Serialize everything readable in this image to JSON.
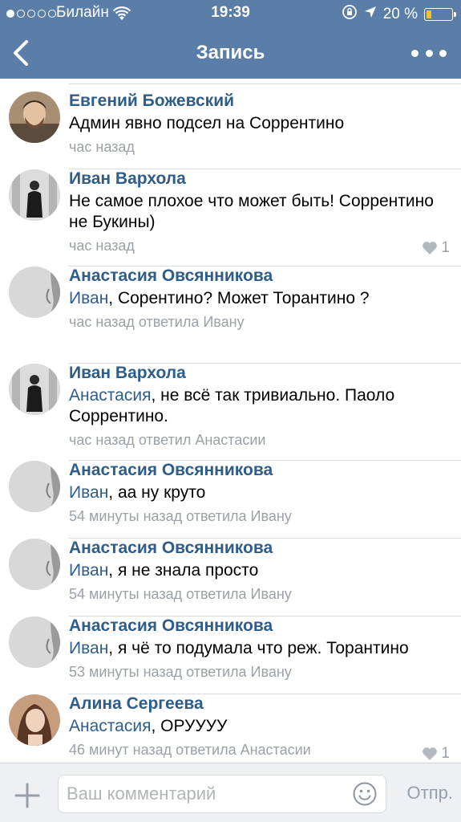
{
  "status_bar": {
    "carrier": "Билайн",
    "time": "19:39",
    "battery_text": "20 %",
    "battery_level": 0.2,
    "battery_color": "#f4c22b"
  },
  "nav": {
    "title": "Запись",
    "back_icon": "chevron-left-icon",
    "more_icon": "more-dots-icon"
  },
  "colors": {
    "header": "#5a7ea8",
    "author": "#2f5d8a",
    "meta": "#9aa1a9"
  },
  "comments": [
    {
      "author": "Евгений Божевский",
      "reply_to": "",
      "text": "Админ явно подсел на Соррентино",
      "meta": "час назад",
      "likes": ""
    },
    {
      "author": "Иван Вархола",
      "reply_to": "",
      "text": "Не самое плохое что может быть! Соррентино не Букины)",
      "meta": "час назад",
      "likes": "1"
    },
    {
      "author": "Анастасия Овсянникова",
      "reply_to": "Иван",
      "text": ", Сорентино? Может Торантино ?",
      "meta": "час назад ответила Ивану",
      "likes": ""
    },
    {
      "author": "Иван Вархола",
      "reply_to": "Анастасия",
      "text": ", не всё так тривиально. Паоло Соррентино.",
      "meta": "час назад ответил Анастасии",
      "likes": ""
    },
    {
      "author": "Анастасия Овсянникова",
      "reply_to": "Иван",
      "text": ", аа ну круто",
      "meta": "54 минуты назад ответила Ивану",
      "likes": ""
    },
    {
      "author": "Анастасия Овсянникова",
      "reply_to": "Иван",
      "text": ", я не знала просто",
      "meta": "54 минуты назад ответила Ивану",
      "likes": ""
    },
    {
      "author": "Анастасия Овсянникова",
      "reply_to": "Иван",
      "text": ", я чё то подумала что реж. Торантино",
      "meta": "53 минуты назад ответила Ивану",
      "likes": ""
    },
    {
      "author": "Алина Сергеева",
      "reply_to": "Анастасия",
      "text": ", ОРУУУУ",
      "meta": "46 минут назад ответила Анастасии",
      "likes": "1"
    }
  ],
  "composer": {
    "placeholder": "Ваш комментарий",
    "send_label": "Отпр.",
    "attach_icon": "plus-icon",
    "emoji_icon": "smiley-icon"
  }
}
